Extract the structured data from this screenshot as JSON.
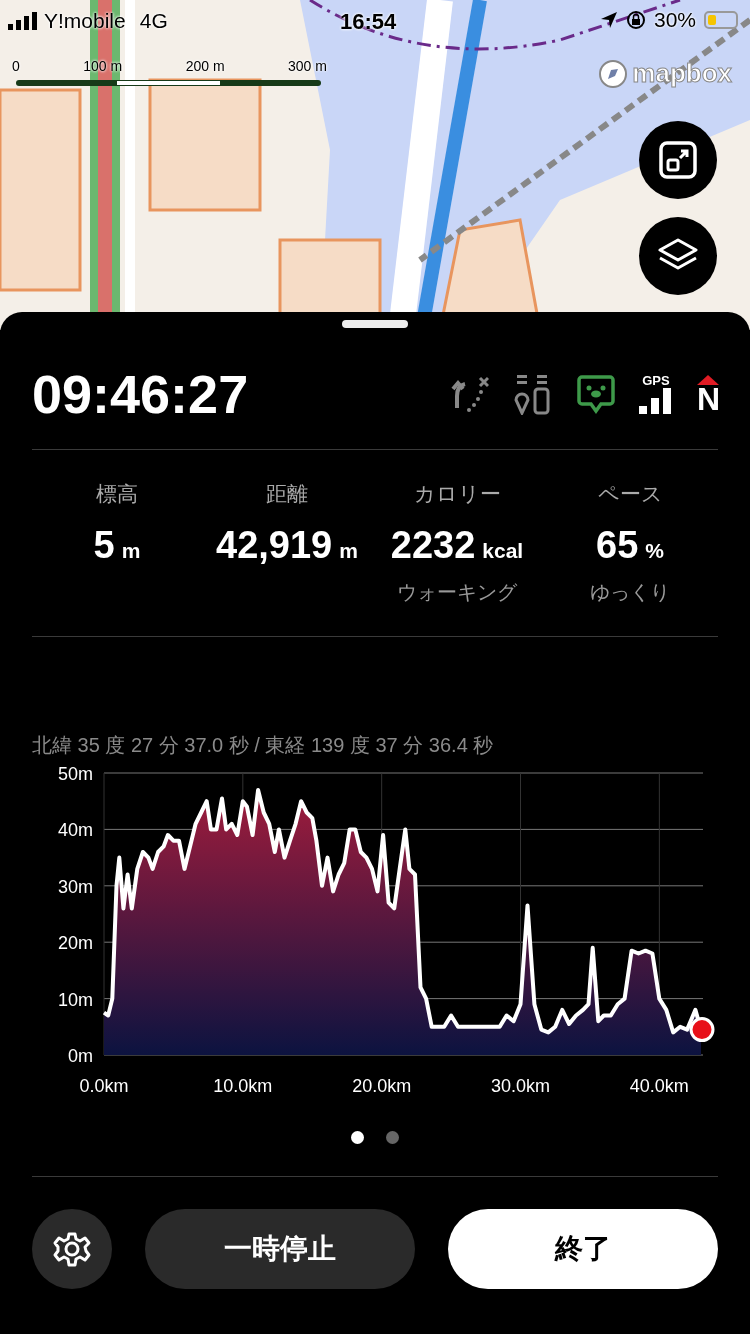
{
  "status_bar": {
    "carrier": "Y!mobile",
    "network": "4G",
    "time": "16:54",
    "battery": "30%"
  },
  "map": {
    "scale_labels": [
      "0",
      "100 m",
      "200 m",
      "300 m"
    ],
    "logo": "mapbox"
  },
  "header": {
    "elapsed": "09:46:27",
    "gps_label": "GPS",
    "compass_label": "N"
  },
  "stats": [
    {
      "label": "標高",
      "value": "5",
      "unit": "m"
    },
    {
      "label": "距離",
      "value": "42,919",
      "unit": "m"
    },
    {
      "label": "カロリー",
      "value": "2232",
      "unit": "kcal",
      "sub": "ウォーキング"
    },
    {
      "label": "ペース",
      "value": "65",
      "unit": "%",
      "sub": "ゆっくり"
    }
  ],
  "coordinates": "北緯 35 度 27 分 37.0 秒 / 東経 139 度 37 分 36.4 秒",
  "chart_data": {
    "type": "area",
    "grid": true,
    "xlim": [
      0,
      43
    ],
    "ylim": [
      0,
      50
    ],
    "xticks": [
      {
        "value": 0,
        "label": "0.0km"
      },
      {
        "value": 10,
        "label": "10.0km"
      },
      {
        "value": 20,
        "label": "20.0km"
      },
      {
        "value": 30,
        "label": "30.0km"
      },
      {
        "value": 40,
        "label": "40.0km"
      }
    ],
    "yticks": [
      {
        "value": 0,
        "label": "0m"
      },
      {
        "value": 10,
        "label": "10m"
      },
      {
        "value": 20,
        "label": "20m"
      },
      {
        "value": 30,
        "label": "30m"
      },
      {
        "value": 40,
        "label": "40m"
      },
      {
        "value": 50,
        "label": "50m"
      }
    ],
    "x": [
      0,
      0.3,
      0.6,
      0.9,
      1.1,
      1.4,
      1.7,
      2.0,
      2.4,
      2.8,
      3.2,
      3.5,
      3.9,
      4.3,
      4.6,
      5.0,
      5.4,
      5.8,
      6.2,
      6.6,
      7.0,
      7.4,
      7.7,
      8.1,
      8.5,
      8.8,
      9.2,
      9.6,
      10.0,
      10.3,
      10.7,
      11.1,
      11.5,
      11.9,
      12.3,
      12.6,
      13.0,
      13.4,
      13.8,
      14.2,
      14.6,
      15.0,
      15.3,
      15.7,
      16.1,
      16.5,
      16.9,
      17.3,
      17.7,
      18.1,
      18.5,
      18.9,
      19.3,
      19.7,
      20.1,
      20.5,
      20.9,
      21.3,
      21.7,
      22.0,
      22.4,
      22.8,
      23.2,
      23.6,
      24.0,
      24.5,
      25.0,
      25.5,
      26.5,
      27.5,
      28.5,
      29.0,
      29.5,
      30.0,
      30.5,
      31.0,
      31.5,
      32.0,
      32.5,
      33.0,
      33.5,
      34.0,
      34.5,
      34.9,
      35.2,
      35.6,
      36.0,
      36.5,
      37.0,
      37.5,
      38.0,
      38.5,
      39.0,
      39.5,
      40.0,
      40.5,
      41.0,
      41.5,
      42.0,
      42.6,
      43.0
    ],
    "series": [
      {
        "color": "#ffffff",
        "values": [
          7.5,
          7,
          10,
          30,
          35,
          26,
          32,
          26,
          33,
          36,
          35,
          33,
          36,
          37,
          39,
          38,
          38,
          33,
          37,
          41,
          43,
          45,
          40,
          40,
          45.5,
          40,
          41,
          39,
          45,
          44,
          39,
          47,
          43,
          41,
          36,
          40,
          35,
          38,
          41,
          45,
          43,
          42,
          38,
          30,
          35,
          29,
          32,
          34,
          40,
          40,
          36,
          35,
          33,
          29,
          39,
          27,
          26,
          33,
          40,
          33,
          32,
          12,
          10,
          5,
          5,
          5,
          7,
          5,
          5,
          5,
          5,
          7,
          6,
          9,
          26.5,
          9,
          4.5,
          4,
          5,
          8,
          5.5,
          7,
          8,
          9,
          19,
          6,
          7,
          7,
          9,
          10,
          18.5,
          18,
          18.5,
          18,
          10,
          8,
          4,
          5,
          4.5,
          8,
          4.5
        ]
      }
    ]
  },
  "pages": [
    {
      "selected": true
    },
    {
      "selected": false
    }
  ],
  "buttons": {
    "pause": "一時停止",
    "finish": "終了"
  }
}
